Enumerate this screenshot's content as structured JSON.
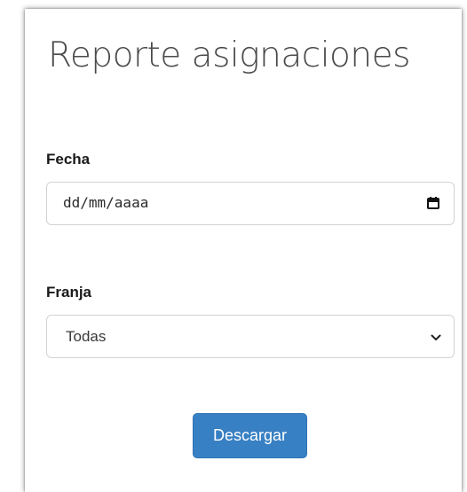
{
  "page": {
    "title": "Reporte asignaciones"
  },
  "form": {
    "fecha_label": "Fecha",
    "fecha_value": "dd/mm/aaaa",
    "franja_label": "Franja",
    "franja_selected": "Todas",
    "submit_label": "Descargar"
  },
  "icons": {
    "date_picker": "calendar-icon",
    "select_toggle": "chevron-down-icon"
  },
  "colors": {
    "primary_button": "#3880c4",
    "field_border": "#cfd3d7",
    "title_text": "#4a4a4a"
  }
}
